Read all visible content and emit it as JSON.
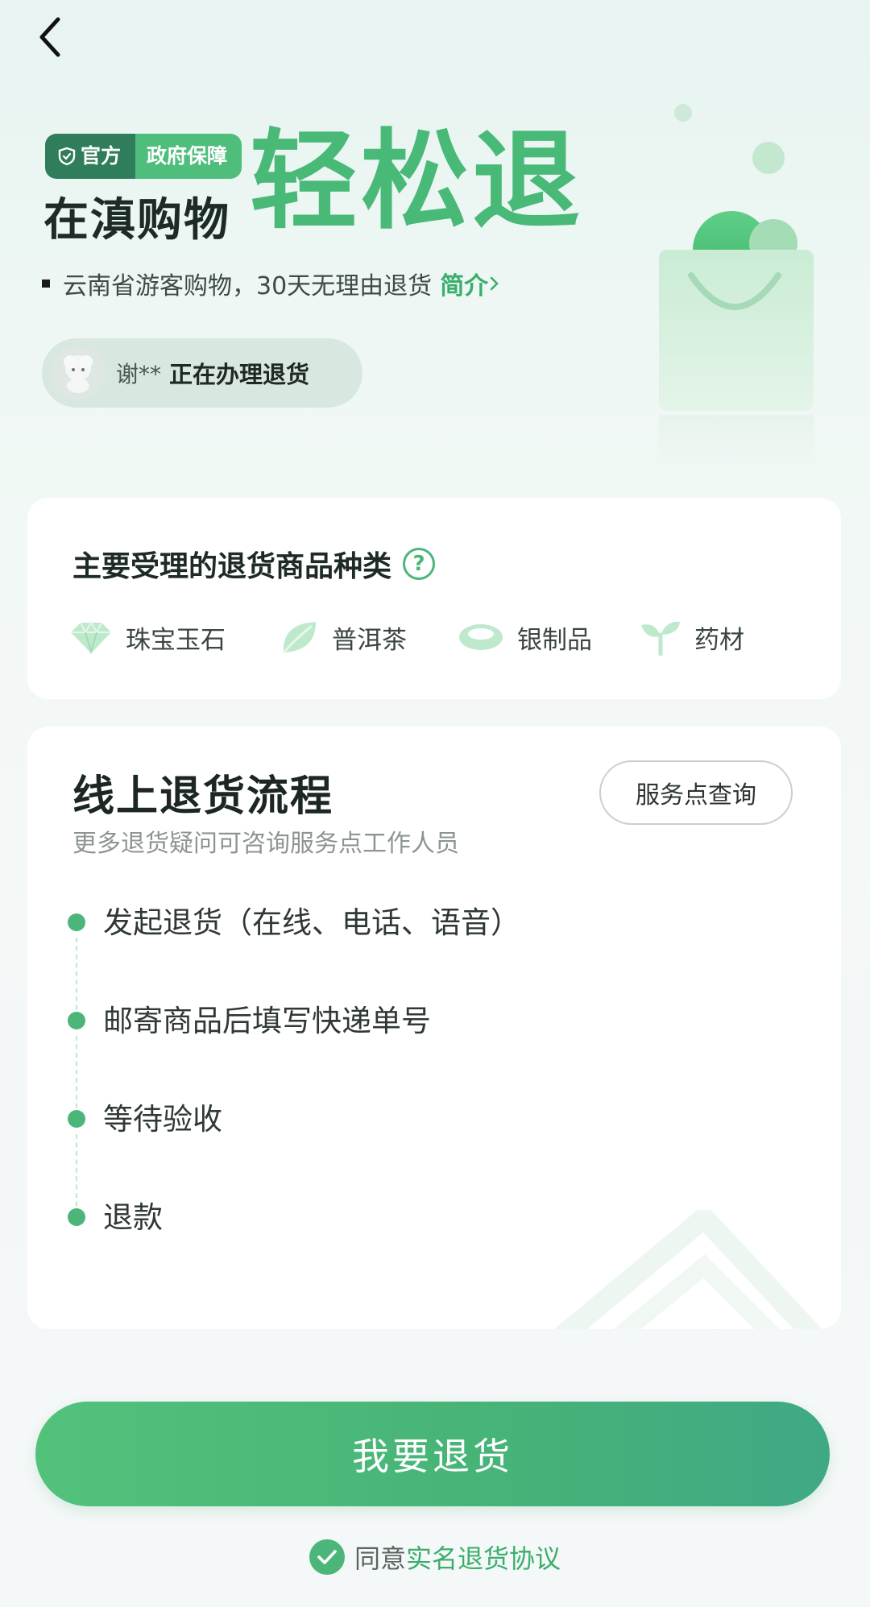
{
  "header": {
    "badge_official": "官方",
    "badge_gov": "政府保障",
    "title_small": "在滇购物",
    "title_big": "轻松退",
    "intro_text": "云南省游客购物，30天无理由退货",
    "intro_link": "简介",
    "ticker_name": "谢**",
    "ticker_status": "正在办理退货"
  },
  "categories_card": {
    "title": "主要受理的退货商品种类",
    "help_icon": "?",
    "items": [
      {
        "label": "珠宝玉石",
        "icon": "gem-icon"
      },
      {
        "label": "普洱茶",
        "icon": "tea-leaf-icon"
      },
      {
        "label": "银制品",
        "icon": "silver-bracelet-icon"
      },
      {
        "label": "药材",
        "icon": "herb-sprout-icon"
      }
    ]
  },
  "process_card": {
    "title": "线上退货流程",
    "subtitle": "更多退货疑问可咨询服务点工作人员",
    "service_button": "服务点查询",
    "steps": [
      "发起退货（在线、电话、语音）",
      "邮寄商品后填写快递单号",
      "等待验收",
      "退款"
    ]
  },
  "footer": {
    "cta_label": "我要退货",
    "agree_prefix": "同意",
    "agree_link": "实名退货协议"
  },
  "colors": {
    "accent": "#4cb67a",
    "title_green": "#49b978",
    "badge_dark": "#2f7d5b"
  }
}
